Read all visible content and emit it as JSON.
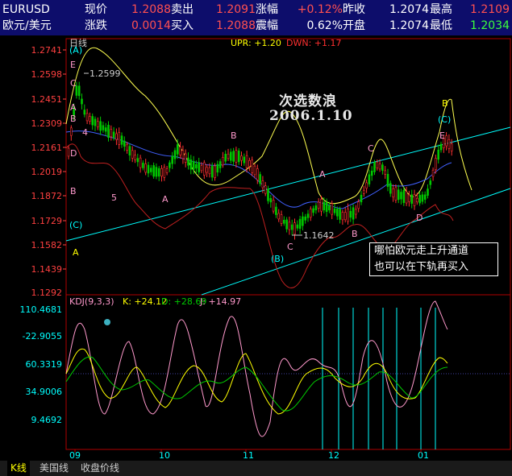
{
  "quote": {
    "symbol": "EURUSD",
    "name": "欧元/美元",
    "row1": [
      {
        "label": "现价",
        "value": "1.2088"
      },
      {
        "label": "卖出",
        "value": "1.2091"
      },
      {
        "label": "涨幅",
        "value": "+0.12%"
      },
      {
        "label": "昨收",
        "value": "1.2074"
      },
      {
        "label": "最高",
        "value": "1.2109"
      }
    ],
    "row2": [
      {
        "label": "涨跌",
        "value": "0.0014"
      },
      {
        "label": "买入",
        "value": "1.2088"
      },
      {
        "label": "震幅",
        "value": "0.62%"
      },
      {
        "label": "开盘",
        "value": "1.2074"
      },
      {
        "label": "最低",
        "value": "1.2034"
      }
    ]
  },
  "main_panel": {
    "period_label": "日线",
    "upr_label": "UPR: +1.20",
    "dn_label": "DWN: +1.17",
    "y_ticks": [
      "1.2741",
      "1.2598",
      "1.2451",
      "1.2309",
      "1.2161",
      "1.2019",
      "1.1872",
      "1.1729",
      "1.1582",
      "1.1439",
      "1.1292"
    ],
    "price_high_label": "1.2599",
    "price_low_label": "1.1642",
    "watermark_title": "次选数浪",
    "watermark_date": "2006.1.10",
    "note_line1": "哪怕欧元走上升通道",
    "note_line2": "也可以在下轨再买入",
    "wave_labels": {
      "A_paren": "(A)",
      "E1": "E",
      "C1": "C",
      "A1": "A",
      "B1": "B",
      "D1": "D",
      "B2": "B",
      "n4": "4",
      "n5": "5",
      "A2": "A",
      "B3": "B",
      "C_paren": "(C)",
      "A3": "A",
      "A4": "A",
      "C2": "C",
      "B_paren": "(B)",
      "B4": "B",
      "C3": "C",
      "D2": "D",
      "E2": "E",
      "C_paren2": "(C)",
      "B5": "B"
    }
  },
  "indicator_panel": {
    "kdj_label": "KDJ(9,3,3)",
    "k_label": "K: +24.12",
    "d_label": "D: +28.69",
    "j_label": "J: +14.97",
    "y_ticks": [
      "110.4681",
      "-22.9055",
      "60.3319",
      "34.9006",
      "9.4692"
    ]
  },
  "x_axis": {
    "months": [
      "09",
      "10",
      "11",
      "12",
      "01"
    ]
  },
  "tabs": [
    "K线",
    "美国线",
    "收盘价线"
  ],
  "colors": {
    "quote_bg": "#0d0d6b",
    "price_red": "#ff5050",
    "price_green": "#3cff3c",
    "channel": "#00ffff",
    "kline_green": "#00c800",
    "kline_red": "#ff3030",
    "yellow": "#ffff00",
    "pink": "#ff99cc"
  }
}
